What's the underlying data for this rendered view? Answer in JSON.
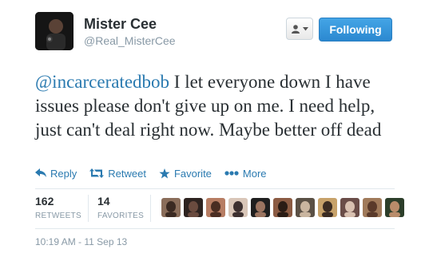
{
  "user": {
    "name": "Mister Cee",
    "handle": "@Real_MisterCee"
  },
  "header": {
    "follow_label": "Following"
  },
  "tweet": {
    "mention": "@incarceratedbob",
    "text": " I let everyone down I have issues please don't give up on me. I need help, just can't deal right now. Maybe better off dead"
  },
  "actions": {
    "reply": "Reply",
    "retweet": "Retweet",
    "favorite": "Favorite",
    "more": "More"
  },
  "stats": {
    "retweets_count": "162",
    "retweets_label": "RETWEETS",
    "favorites_count": "14",
    "favorites_label": "FAVORITES"
  },
  "timestamp": "10:19 AM - 11 Sep 13",
  "colors": {
    "link": "#2a7ab0",
    "follow_button": "#2b88d0",
    "muted": "#8899a6"
  },
  "icons": [
    "user-icon",
    "caret-down-icon",
    "reply-icon",
    "retweet-icon",
    "star-icon",
    "more-dots-icon"
  ],
  "favoriter_avatars": [
    {
      "bg": "#8a6d5a",
      "fg": "#3b2a22"
    },
    {
      "bg": "#2d2320",
      "fg": "#6a4b3f"
    },
    {
      "bg": "#b77d63",
      "fg": "#4a2d22"
    },
    {
      "bg": "#d9c6b8",
      "fg": "#3d3030"
    },
    {
      "bg": "#1f1f1f",
      "fg": "#9b7460"
    },
    {
      "bg": "#8b5b43",
      "fg": "#2a1c15"
    },
    {
      "bg": "#5a5045",
      "fg": "#c9b59f"
    },
    {
      "bg": "#c7a26a",
      "fg": "#3b2c22"
    },
    {
      "bg": "#6a4d48",
      "fg": "#d8c0b0"
    },
    {
      "bg": "#a07a5a",
      "fg": "#5a3a2a"
    },
    {
      "bg": "#2c3e2a",
      "fg": "#b98c6a"
    }
  ]
}
